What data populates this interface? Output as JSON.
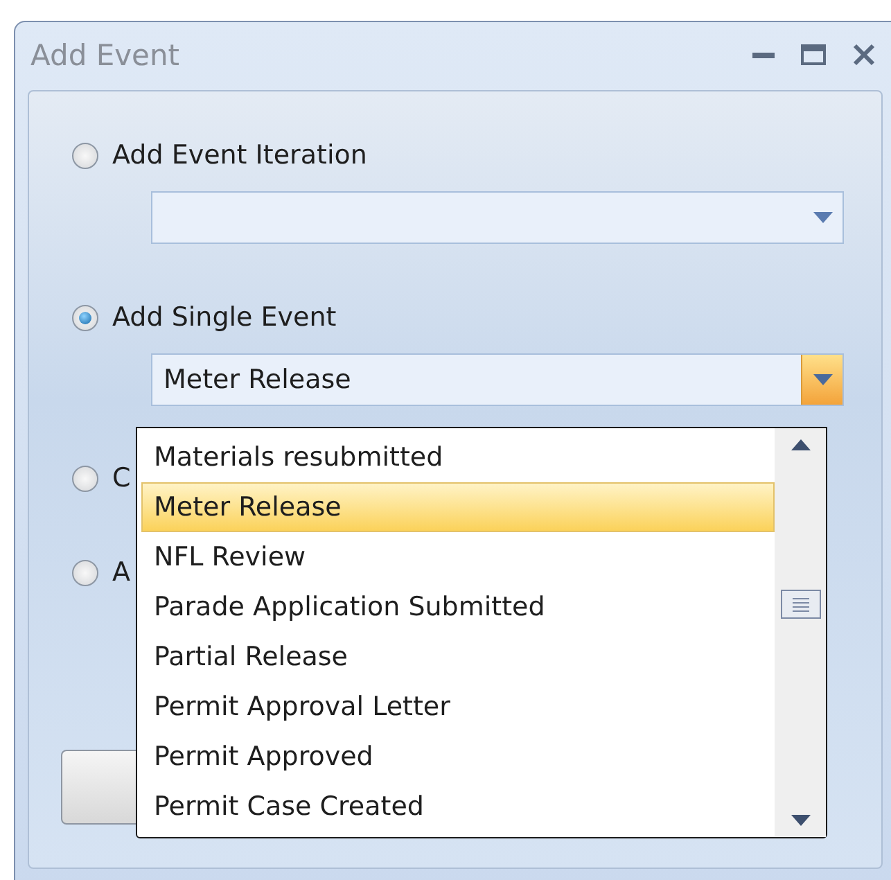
{
  "window": {
    "title": "Add Event"
  },
  "options": [
    {
      "label": "Add Event Iteration",
      "selected": false,
      "combo": {
        "open": false
      }
    },
    {
      "label": "Add Single Event",
      "selected": true,
      "combo": {
        "value": "Meter Release",
        "open": true
      }
    },
    {
      "label": "C",
      "selected": false
    },
    {
      "label": "A",
      "selected": false
    }
  ],
  "dropdown": {
    "items": [
      {
        "label": "Materials resubmitted",
        "selected": false
      },
      {
        "label": "Meter Release",
        "selected": true
      },
      {
        "label": "NFL Review",
        "selected": false
      },
      {
        "label": "Parade Application Submitted",
        "selected": false
      },
      {
        "label": "Partial Release",
        "selected": false
      },
      {
        "label": "Permit Approval Letter",
        "selected": false
      },
      {
        "label": "Permit Approved",
        "selected": false
      },
      {
        "label": "Permit Case Created",
        "selected": false
      }
    ]
  }
}
